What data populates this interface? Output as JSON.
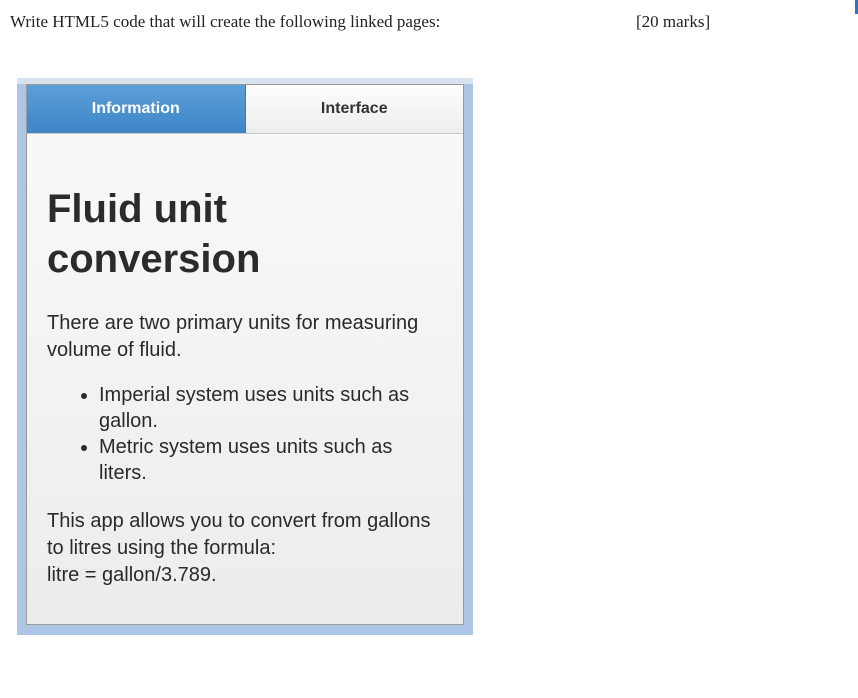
{
  "question": {
    "text": "Write HTML5 code that will create the following linked pages:",
    "marks": "[20 marks]"
  },
  "app": {
    "tabs": [
      {
        "label": "Information",
        "active": true
      },
      {
        "label": "Interface",
        "active": false
      }
    ],
    "title_line1": "Fluid unit",
    "title_line2": "conversion",
    "intro": "There are two primary units for measuring volume of fluid.",
    "bullets": [
      "Imperial system uses units such as gallon.",
      "Metric system uses units such as liters."
    ],
    "formula_line1": "This app allows you to convert from gallons to litres using the formula:",
    "formula_line2": "litre = gallon/3.789."
  },
  "colors": {
    "active_tab": "#4a90d0",
    "frame": "#aec6e6"
  }
}
